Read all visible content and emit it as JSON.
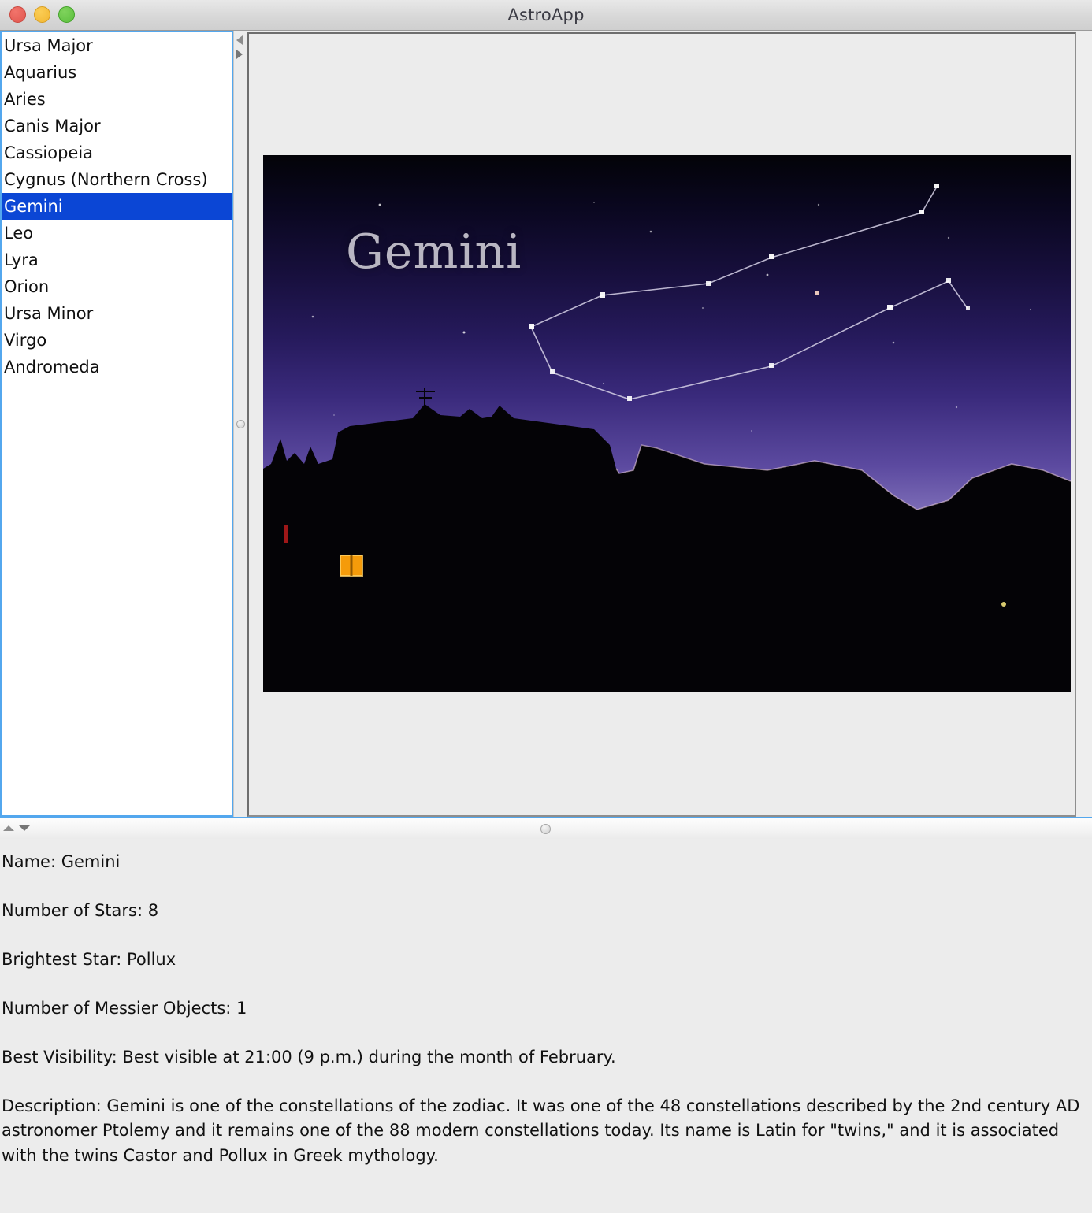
{
  "window": {
    "title": "AstroApp",
    "controls": [
      {
        "name": "close-button",
        "color": "#e0564f"
      },
      {
        "name": "minimize-button",
        "color": "#f2b733"
      },
      {
        "name": "maximize-button",
        "color": "#5cbf3e"
      }
    ]
  },
  "list": {
    "items": [
      {
        "label": "Ursa Major",
        "selected": false
      },
      {
        "label": "Aquarius",
        "selected": false
      },
      {
        "label": "Aries",
        "selected": false
      },
      {
        "label": "Canis Major",
        "selected": false
      },
      {
        "label": "Cassiopeia",
        "selected": false
      },
      {
        "label": "Cygnus (Northern Cross)",
        "selected": false
      },
      {
        "label": "Gemini",
        "selected": true
      },
      {
        "label": "Leo",
        "selected": false
      },
      {
        "label": "Lyra",
        "selected": false
      },
      {
        "label": "Orion",
        "selected": false
      },
      {
        "label": "Ursa Minor",
        "selected": false
      },
      {
        "label": "Virgo",
        "selected": false
      },
      {
        "label": "Andromeda",
        "selected": false
      }
    ],
    "selection_color": "#0b46d5",
    "focus_border_color": "#53a7ee"
  },
  "dividers": {
    "vertical": {
      "collapse_left_icon": "triangle-left-icon",
      "collapse_right_icon": "triangle-right-icon",
      "grip_icon": "circle-grip-icon"
    },
    "horizontal": {
      "collapse_up_icon": "triangle-up-icon",
      "collapse_down_icon": "triangle-down-icon",
      "grip_icon": "circle-grip-icon"
    }
  },
  "image_panel": {
    "photo_caption": "Gemini",
    "alt": "Night sky photograph of the Gemini constellation over a hillside silhouette at dusk"
  },
  "info": {
    "name_line": "Name: Gemini",
    "stars_line": "Number of Stars: 8",
    "brightest_line": "Brightest Star: Pollux",
    "messier_line": "Number of Messier Objects: 1",
    "visibility_line": "Best Visibility: Best visible at 21:00 (9 p.m.) during the month of February.",
    "description_line": "Description: Gemini is one of the constellations of the zodiac. It was one of the 48 constellations described by the 2nd century AD astronomer Ptolemy and it remains one of the 88 modern constellations today. Its name is Latin for \"twins,\" and it is associated with the twins Castor and Pollux in Greek mythology."
  }
}
